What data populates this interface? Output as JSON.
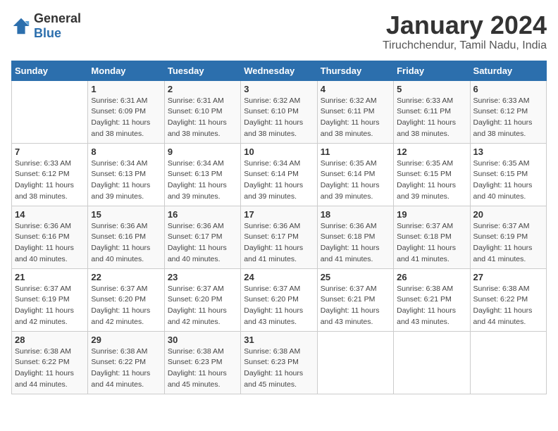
{
  "header": {
    "logo": {
      "general": "General",
      "blue": "Blue"
    },
    "title": "January 2024",
    "location": "Tiruchchendur, Tamil Nadu, India"
  },
  "calendar": {
    "days_of_week": [
      "Sunday",
      "Monday",
      "Tuesday",
      "Wednesday",
      "Thursday",
      "Friday",
      "Saturday"
    ],
    "weeks": [
      [
        {
          "day": "",
          "info": ""
        },
        {
          "day": "1",
          "info": "Sunrise: 6:31 AM\nSunset: 6:09 PM\nDaylight: 11 hours\nand 38 minutes."
        },
        {
          "day": "2",
          "info": "Sunrise: 6:31 AM\nSunset: 6:10 PM\nDaylight: 11 hours\nand 38 minutes."
        },
        {
          "day": "3",
          "info": "Sunrise: 6:32 AM\nSunset: 6:10 PM\nDaylight: 11 hours\nand 38 minutes."
        },
        {
          "day": "4",
          "info": "Sunrise: 6:32 AM\nSunset: 6:11 PM\nDaylight: 11 hours\nand 38 minutes."
        },
        {
          "day": "5",
          "info": "Sunrise: 6:33 AM\nSunset: 6:11 PM\nDaylight: 11 hours\nand 38 minutes."
        },
        {
          "day": "6",
          "info": "Sunrise: 6:33 AM\nSunset: 6:12 PM\nDaylight: 11 hours\nand 38 minutes."
        }
      ],
      [
        {
          "day": "7",
          "info": "Sunrise: 6:33 AM\nSunset: 6:12 PM\nDaylight: 11 hours\nand 38 minutes."
        },
        {
          "day": "8",
          "info": "Sunrise: 6:34 AM\nSunset: 6:13 PM\nDaylight: 11 hours\nand 39 minutes."
        },
        {
          "day": "9",
          "info": "Sunrise: 6:34 AM\nSunset: 6:13 PM\nDaylight: 11 hours\nand 39 minutes."
        },
        {
          "day": "10",
          "info": "Sunrise: 6:34 AM\nSunset: 6:14 PM\nDaylight: 11 hours\nand 39 minutes."
        },
        {
          "day": "11",
          "info": "Sunrise: 6:35 AM\nSunset: 6:14 PM\nDaylight: 11 hours\nand 39 minutes."
        },
        {
          "day": "12",
          "info": "Sunrise: 6:35 AM\nSunset: 6:15 PM\nDaylight: 11 hours\nand 39 minutes."
        },
        {
          "day": "13",
          "info": "Sunrise: 6:35 AM\nSunset: 6:15 PM\nDaylight: 11 hours\nand 40 minutes."
        }
      ],
      [
        {
          "day": "14",
          "info": "Sunrise: 6:36 AM\nSunset: 6:16 PM\nDaylight: 11 hours\nand 40 minutes."
        },
        {
          "day": "15",
          "info": "Sunrise: 6:36 AM\nSunset: 6:16 PM\nDaylight: 11 hours\nand 40 minutes."
        },
        {
          "day": "16",
          "info": "Sunrise: 6:36 AM\nSunset: 6:17 PM\nDaylight: 11 hours\nand 40 minutes."
        },
        {
          "day": "17",
          "info": "Sunrise: 6:36 AM\nSunset: 6:17 PM\nDaylight: 11 hours\nand 41 minutes."
        },
        {
          "day": "18",
          "info": "Sunrise: 6:36 AM\nSunset: 6:18 PM\nDaylight: 11 hours\nand 41 minutes."
        },
        {
          "day": "19",
          "info": "Sunrise: 6:37 AM\nSunset: 6:18 PM\nDaylight: 11 hours\nand 41 minutes."
        },
        {
          "day": "20",
          "info": "Sunrise: 6:37 AM\nSunset: 6:19 PM\nDaylight: 11 hours\nand 41 minutes."
        }
      ],
      [
        {
          "day": "21",
          "info": "Sunrise: 6:37 AM\nSunset: 6:19 PM\nDaylight: 11 hours\nand 42 minutes."
        },
        {
          "day": "22",
          "info": "Sunrise: 6:37 AM\nSunset: 6:20 PM\nDaylight: 11 hours\nand 42 minutes."
        },
        {
          "day": "23",
          "info": "Sunrise: 6:37 AM\nSunset: 6:20 PM\nDaylight: 11 hours\nand 42 minutes."
        },
        {
          "day": "24",
          "info": "Sunrise: 6:37 AM\nSunset: 6:20 PM\nDaylight: 11 hours\nand 43 minutes."
        },
        {
          "day": "25",
          "info": "Sunrise: 6:37 AM\nSunset: 6:21 PM\nDaylight: 11 hours\nand 43 minutes."
        },
        {
          "day": "26",
          "info": "Sunrise: 6:38 AM\nSunset: 6:21 PM\nDaylight: 11 hours\nand 43 minutes."
        },
        {
          "day": "27",
          "info": "Sunrise: 6:38 AM\nSunset: 6:22 PM\nDaylight: 11 hours\nand 44 minutes."
        }
      ],
      [
        {
          "day": "28",
          "info": "Sunrise: 6:38 AM\nSunset: 6:22 PM\nDaylight: 11 hours\nand 44 minutes."
        },
        {
          "day": "29",
          "info": "Sunrise: 6:38 AM\nSunset: 6:22 PM\nDaylight: 11 hours\nand 44 minutes."
        },
        {
          "day": "30",
          "info": "Sunrise: 6:38 AM\nSunset: 6:23 PM\nDaylight: 11 hours\nand 45 minutes."
        },
        {
          "day": "31",
          "info": "Sunrise: 6:38 AM\nSunset: 6:23 PM\nDaylight: 11 hours\nand 45 minutes."
        },
        {
          "day": "",
          "info": ""
        },
        {
          "day": "",
          "info": ""
        },
        {
          "day": "",
          "info": ""
        }
      ]
    ]
  }
}
